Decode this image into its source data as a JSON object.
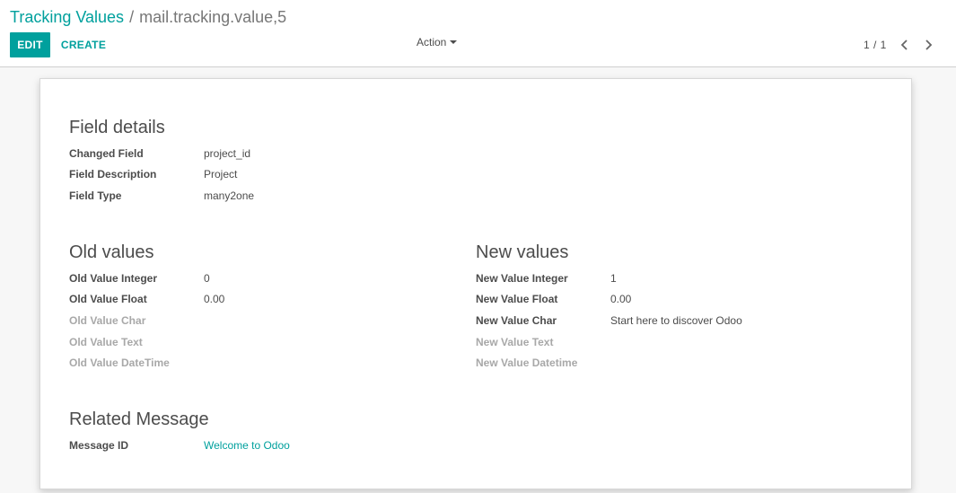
{
  "breadcrumb": {
    "parent": "Tracking Values",
    "separator": "/",
    "current": "mail.tracking.value,5"
  },
  "toolbar": {
    "edit_label": "EDIT",
    "create_label": "CREATE",
    "action_label": "Action"
  },
  "pager": {
    "value": "1 / 1"
  },
  "colors": {
    "accent": "#00a09d",
    "muted_label": "#a8a8a8",
    "text": "#4c4c4c"
  },
  "field_details": {
    "title": "Field details",
    "fields": [
      {
        "label": "Changed Field",
        "value": "project_id"
      },
      {
        "label": "Field Description",
        "value": "Project"
      },
      {
        "label": "Field Type",
        "value": "many2one"
      }
    ]
  },
  "old_values": {
    "title": "Old values",
    "fields": [
      {
        "label": "Old Value Integer",
        "value": "0"
      },
      {
        "label": "Old Value Float",
        "value": "0.00"
      },
      {
        "label": "Old Value Char",
        "value": ""
      },
      {
        "label": "Old Value Text",
        "value": ""
      },
      {
        "label": "Old Value DateTime",
        "value": ""
      }
    ]
  },
  "new_values": {
    "title": "New values",
    "fields": [
      {
        "label": "New Value Integer",
        "value": "1"
      },
      {
        "label": "New Value Float",
        "value": "0.00"
      },
      {
        "label": "New Value Char",
        "value": "Start here to discover Odoo"
      },
      {
        "label": "New Value Text",
        "value": ""
      },
      {
        "label": "New Value Datetime",
        "value": ""
      }
    ]
  },
  "related_message": {
    "title": "Related Message",
    "fields": [
      {
        "label": "Message ID",
        "value": "Welcome to Odoo"
      }
    ]
  }
}
